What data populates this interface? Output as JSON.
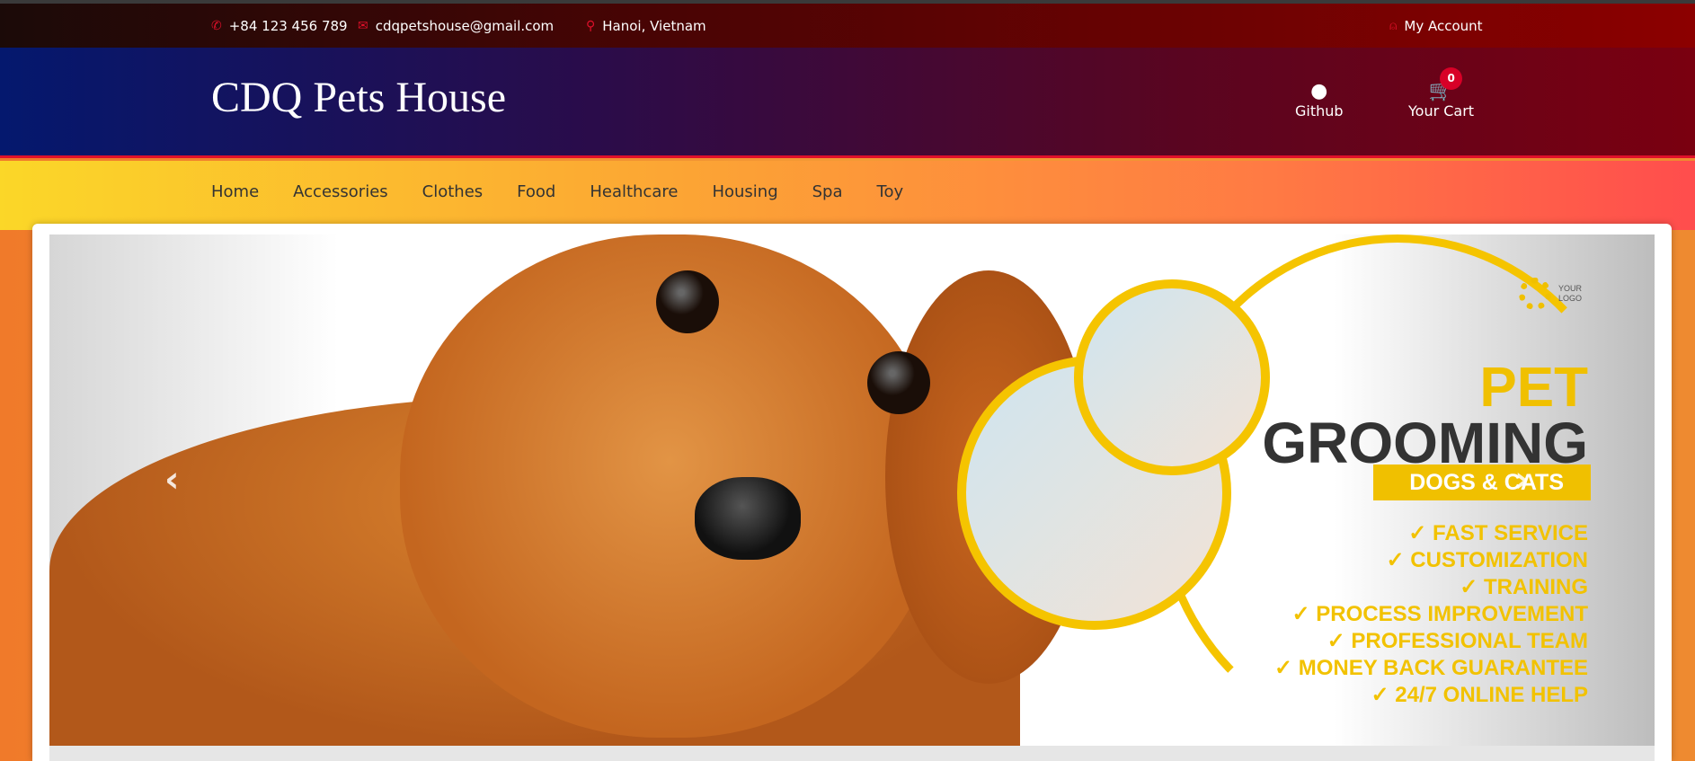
{
  "topbar": {
    "phone": "+84 123 456 789",
    "email": "cdqpetshouse@gmail.com",
    "location": "Hanoi, Vietnam",
    "account": "My Account"
  },
  "header": {
    "logo": "CDQ Pets House",
    "github": "Github",
    "cart": "Your Cart",
    "cart_count": "0"
  },
  "nav": [
    "Home",
    "Accessories",
    "Clothes",
    "Food",
    "Healthcare",
    "Housing",
    "Spa",
    "Toy"
  ],
  "slide": {
    "logo_text_1": "YOUR",
    "logo_text_2": "LOGO",
    "title_1": "PET",
    "title_2": "GROOMING",
    "subtitle": "DOGS & CATS",
    "features": [
      "✓ FAST SERVICE",
      "✓ CUSTOMIZATION",
      "✓ TRAINING",
      "✓ PROCESS IMPROVEMENT",
      "✓ PROFESSIONAL TEAM",
      "✓ MONEY BACK GUARANTEE",
      "✓ 24/7 ONLINE HELP"
    ]
  },
  "colors": {
    "accent": "#d80027",
    "promo_yellow": "#f0c000"
  }
}
